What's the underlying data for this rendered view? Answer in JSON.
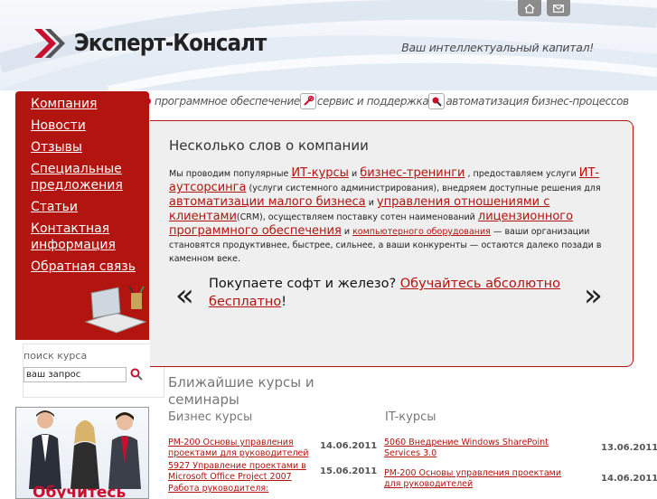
{
  "header": {
    "logo_text": "Эксперт-Консалт",
    "tagline": "Ваш интеллектуальный капитал!",
    "icons": [
      "home-icon",
      "mail-icon"
    ]
  },
  "topnav": {
    "items": [
      {
        "label": "программное обеспечение",
        "icon": "software-icon"
      },
      {
        "label": "сервис и поддержка",
        "icon": "service-icon"
      },
      {
        "label": "автоматизация бизнес-процессов",
        "icon": "automation-icon"
      }
    ]
  },
  "sidebar": {
    "items": [
      "Компания",
      "Новости",
      "Отзывы",
      "Специальные предложения",
      "Статьи",
      "Контактная информация",
      "Обратная связь"
    ]
  },
  "search": {
    "label": "поиск курса",
    "value": "ваш запрос"
  },
  "promo_banner": {
    "text": "Обучитесь"
  },
  "content": {
    "title": "Несколько слов о компании",
    "p1": "Мы проводим популярные",
    "l1": "ИТ-курсы",
    "p2": "и",
    "l2": "бизнес-тренинги",
    "p3": ", предоставляем услуги",
    "l3": "ИТ-аутсорсинга",
    "p4": "(услуги системного администрирования), внедряем доступные решения для",
    "l4": "автоматизации малого бизнеса",
    "p5": "и",
    "l5": "управления отношениями с клиентами",
    "p6": "(CRM), осуществляем поставку сотен наименований",
    "l6": "лицензионного программного обеспечения",
    "p7": "и",
    "l7": "компьютерного оборудования",
    "p8": "— ваши организации становятся продуктивнее, быстрее, сильнее, а ваши конкуренты — остаются далеко позади в каменном веке.",
    "promo_q": "Покупаете софт и железо?",
    "promo_link": "Обучайтесь абсолютно бесплатно",
    "promo_end": "!",
    "prev_arrow": "«",
    "next_arrow": "»"
  },
  "courses": {
    "title": "Ближайшие курсы и семинары",
    "business_header": "Бизнес курсы",
    "it_header": "IT-курсы",
    "business": [
      {
        "title": "PM-200 Основы управления проектами для руководителей",
        "date": "14.06.2011"
      },
      {
        "title": "5927 Управление проектами в Microsoft Office Project 2007",
        "date": "15.06.2011"
      },
      {
        "title": "Работа руководителя:",
        "date": ""
      }
    ],
    "it": [
      {
        "title": "5060 Внедрение Windows SharePoint Services 3.0",
        "date": "13.06.2011"
      },
      {
        "title": "PM-200 Основы управления проектами для руководителей",
        "date": "14.06.2011"
      }
    ]
  },
  "colors": {
    "brand_red": "#b2140f",
    "link_red": "#b2140f",
    "content_bg": "#efefef"
  }
}
